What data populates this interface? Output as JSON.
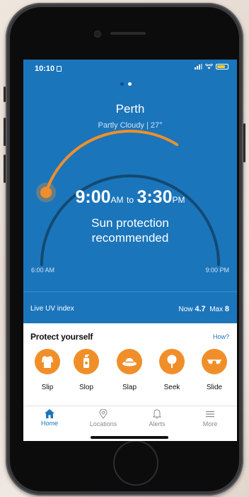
{
  "status": {
    "time": "10:10"
  },
  "pager": {
    "pages": 2,
    "active": 2
  },
  "location": {
    "city": "Perth",
    "weather": "Partly Cloudy | 27°"
  },
  "protection": {
    "start_time": "9:00",
    "start_suffix": "AM",
    "connector": "to",
    "end_time": "3:30",
    "end_suffix": "PM",
    "line1": "Sun protection",
    "line2": "recommended",
    "day_start": "6:00 AM",
    "day_end": "9:00 PM",
    "current_progress": 0.2
  },
  "uv": {
    "label": "Live UV index",
    "now_label": "Now",
    "now_value": "4.7",
    "max_label": "Max",
    "max_value": "8"
  },
  "protect": {
    "title": "Protect yourself",
    "how_label": "How?",
    "actions": [
      {
        "label": "Slip",
        "icon": "shirt-icon"
      },
      {
        "label": "Slop",
        "icon": "sunscreen-icon"
      },
      {
        "label": "Slap",
        "icon": "hat-icon"
      },
      {
        "label": "Seek",
        "icon": "tree-icon"
      },
      {
        "label": "Slide",
        "icon": "sunglasses-icon"
      }
    ]
  },
  "tabs": [
    {
      "label": "Home",
      "icon": "home-icon",
      "active": true
    },
    {
      "label": "Locations",
      "icon": "location-pin-icon"
    },
    {
      "label": "Alerts",
      "icon": "bell-icon"
    },
    {
      "label": "More",
      "icon": "menu-icon"
    }
  ],
  "colors": {
    "app_blue": "#1b75bb",
    "accent_orange": "#f08f2a",
    "arc_dark": "#124a73"
  }
}
